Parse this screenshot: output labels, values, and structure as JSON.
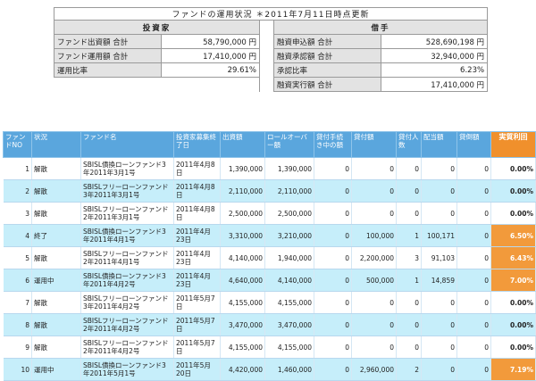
{
  "summary": {
    "title": "ファンドの運用状況 ＊2011年7月11日時点更新",
    "investor_header": "投資家",
    "borrower_header": "借手",
    "rows": [
      {
        "il": "ファンド出資額 合計",
        "iv": "58,790,000 円",
        "bl": "融資申込額 合計",
        "bv": "528,690,198 円"
      },
      {
        "il": "ファンド運用額 合計",
        "iv": "17,410,000 円",
        "bl": "融資承認額 合計",
        "bv": "32,940,000 円"
      },
      {
        "il": "運用比率",
        "iv": "29.61%",
        "bl": "承認比率",
        "bv": "6.23%"
      },
      {
        "il": "",
        "iv": "",
        "bl": "融資実行額 合計",
        "bv": "17,410,000 円"
      }
    ]
  },
  "table": {
    "headers": [
      "ファンドNO",
      "状況",
      "ファンド名",
      "投資家募集終了日",
      "出資額",
      "ロールオーバー額",
      "貸付手続き中の額",
      "貸付額",
      "貸付人数",
      "配当額",
      "貸倒額",
      "実質利回"
    ],
    "rows": [
      {
        "no": "1",
        "status": "解散",
        "name": "SBISL債換ローンファンド3年2011年3月1号",
        "date": "2011年4月8日",
        "invest": "1,390,000",
        "rollover": "1,390,000",
        "pending": "0",
        "loan": "0",
        "people": "0",
        "dividend": "0",
        "default": "0",
        "rate": "0.00%",
        "hot": false
      },
      {
        "no": "2",
        "status": "解散",
        "name": "SBISLフリーローンファンド3年2011年3月1号",
        "date": "2011年4月8日",
        "invest": "2,110,000",
        "rollover": "2,110,000",
        "pending": "0",
        "loan": "0",
        "people": "0",
        "dividend": "0",
        "default": "0",
        "rate": "0.00%",
        "hot": false
      },
      {
        "no": "3",
        "status": "解散",
        "name": "SBISLフリーローンファンド2年2011年3月1号",
        "date": "2011年4月8日",
        "invest": "2,500,000",
        "rollover": "2,500,000",
        "pending": "0",
        "loan": "0",
        "people": "0",
        "dividend": "0",
        "default": "0",
        "rate": "0.00%",
        "hot": false
      },
      {
        "no": "4",
        "status": "終了",
        "name": "SBISL債換ローンファンド3年2011年4月1号",
        "date": "2011年4月23日",
        "invest": "3,310,000",
        "rollover": "3,210,000",
        "pending": "0",
        "loan": "100,000",
        "people": "1",
        "dividend": "100,171",
        "default": "0",
        "rate": "6.50%",
        "hot": true
      },
      {
        "no": "5",
        "status": "解散",
        "name": "SBISLフリーローンファンド2年2011年4月1号",
        "date": "2011年4月23日",
        "invest": "4,140,000",
        "rollover": "1,940,000",
        "pending": "0",
        "loan": "2,200,000",
        "people": "3",
        "dividend": "91,103",
        "default": "0",
        "rate": "6.43%",
        "hot": true
      },
      {
        "no": "6",
        "status": "運用中",
        "name": "SBISL債換ローンファンド3年2011年4月2号",
        "date": "2011年4月23日",
        "invest": "4,640,000",
        "rollover": "4,140,000",
        "pending": "0",
        "loan": "500,000",
        "people": "1",
        "dividend": "14,859",
        "default": "0",
        "rate": "7.00%",
        "hot": true
      },
      {
        "no": "7",
        "status": "解散",
        "name": "SBISLフリーローンファンド3年2011年4月2号",
        "date": "2011年5月7日",
        "invest": "4,155,000",
        "rollover": "4,155,000",
        "pending": "0",
        "loan": "0",
        "people": "0",
        "dividend": "0",
        "default": "0",
        "rate": "0.00%",
        "hot": false
      },
      {
        "no": "8",
        "status": "解散",
        "name": "SBISLフリーローンファンド2年2011年4月2号",
        "date": "2011年5月7日",
        "invest": "3,470,000",
        "rollover": "3,470,000",
        "pending": "0",
        "loan": "0",
        "people": "0",
        "dividend": "0",
        "default": "0",
        "rate": "0.00%",
        "hot": false
      },
      {
        "no": "9",
        "status": "解散",
        "name": "SBISLフリーローンファンド2年2011年4月2号",
        "date": "2011年5月7日",
        "invest": "4,155,000",
        "rollover": "4,155,000",
        "pending": "0",
        "loan": "0",
        "people": "0",
        "dividend": "0",
        "default": "0",
        "rate": "0.00%",
        "hot": false
      },
      {
        "no": "10",
        "status": "運用中",
        "name": "SBISL債換ローンファンド3年2011年5月1号",
        "date": "2011年5月20日",
        "invest": "4,420,000",
        "rollover": "1,460,000",
        "pending": "0",
        "loan": "2,960,000",
        "people": "2",
        "dividend": "0",
        "default": "0",
        "rate": "7.19%",
        "hot": true
      }
    ]
  }
}
